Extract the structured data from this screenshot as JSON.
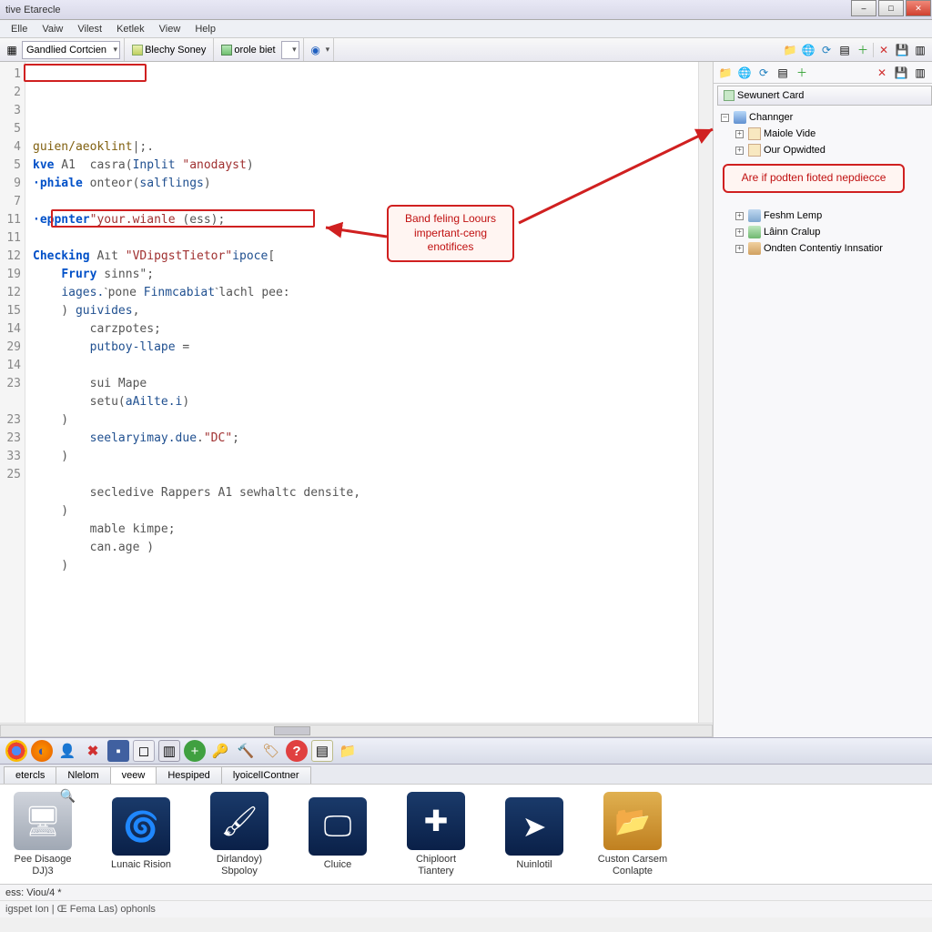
{
  "window": {
    "title": "tive Etarecle"
  },
  "menu": {
    "items": [
      "Elle",
      "Vaiw",
      "Vilest",
      "Ketlek",
      "View",
      "Help"
    ]
  },
  "toolbar": {
    "combo1": "Gandlied Cortcien",
    "btn_blechy": "Blechy Soney",
    "btn_orole": "orole biet"
  },
  "code": {
    "gutter": [
      "1",
      "2",
      "3",
      "5",
      "4",
      "5",
      "9",
      "7",
      "11",
      "11",
      "12",
      "19",
      "12",
      "15",
      "14",
      "29",
      "14",
      "23",
      "",
      "23",
      "23",
      "33",
      "25",
      ""
    ],
    "lines": [
      {
        "segments": [
          {
            "cls": "id",
            "t": "guien/aeoklint"
          },
          {
            "cls": "pl",
            "t": "|;."
          }
        ]
      },
      {
        "segments": [
          {
            "cls": "kw",
            "t": "kve"
          },
          {
            "cls": "pl",
            "t": " A1  casra("
          },
          {
            "cls": "fn",
            "t": "Inplit"
          },
          {
            "cls": "pl",
            "t": " "
          },
          {
            "cls": "str",
            "t": "\"anodayst"
          },
          {
            "cls": "pl",
            "t": ")"
          }
        ]
      },
      {
        "segments": [
          {
            "cls": "kw",
            "t": "·phiale"
          },
          {
            "cls": "pl",
            "t": " onteor("
          },
          {
            "cls": "fn",
            "t": "salflings"
          },
          {
            "cls": "pl",
            "t": ")"
          }
        ]
      },
      {
        "segments": []
      },
      {
        "segments": [
          {
            "cls": "kw",
            "t": "·eppnter"
          },
          {
            "cls": "str",
            "t": "\"your.wianle"
          },
          {
            "cls": "pl",
            "t": " (ess);"
          }
        ]
      },
      {
        "segments": []
      },
      {
        "segments": [
          {
            "cls": "kw",
            "t": "Checking"
          },
          {
            "cls": "pl",
            "t": " Aıt "
          },
          {
            "cls": "str",
            "t": "\"VDipgstTietor\""
          },
          {
            "cls": "fn",
            "t": "ipoce"
          },
          {
            "cls": "pl",
            "t": "["
          }
        ]
      },
      {
        "segments": [
          {
            "cls": "pl",
            "t": "    "
          },
          {
            "cls": "kw",
            "t": "Frury"
          },
          {
            "cls": "pl",
            "t": " sinns\";"
          }
        ]
      },
      {
        "segments": [
          {
            "cls": "pl",
            "t": "    "
          },
          {
            "cls": "fn",
            "t": "iages."
          },
          {
            "cls": "pl",
            "t": "ˋpone "
          },
          {
            "cls": "fn",
            "t": "Finmcabiat"
          },
          {
            "cls": "pl",
            "t": "ˋlachl pee:"
          }
        ]
      },
      {
        "segments": [
          {
            "cls": "pl",
            "t": "    ) "
          },
          {
            "cls": "fn",
            "t": "guivides"
          },
          {
            "cls": "pl",
            "t": ","
          }
        ]
      },
      {
        "segments": [
          {
            "cls": "pl",
            "t": "        carzpotes;"
          }
        ]
      },
      {
        "segments": [
          {
            "cls": "pl",
            "t": "        "
          },
          {
            "cls": "fn",
            "t": "putboy-llape"
          },
          {
            "cls": "pl",
            "t": " ="
          }
        ]
      },
      {
        "segments": []
      },
      {
        "segments": [
          {
            "cls": "pl",
            "t": "        sui Mape"
          }
        ]
      },
      {
        "segments": [
          {
            "cls": "pl",
            "t": "        setu("
          },
          {
            "cls": "fn",
            "t": "aAilte.i"
          },
          {
            "cls": "pl",
            "t": ")"
          }
        ]
      },
      {
        "segments": [
          {
            "cls": "pl",
            "t": "    )"
          }
        ]
      },
      {
        "segments": [
          {
            "cls": "pl",
            "t": "        "
          },
          {
            "cls": "fn",
            "t": "seelaryimay.due"
          },
          {
            "cls": "pl",
            "t": "."
          },
          {
            "cls": "str",
            "t": "\"DC\""
          },
          {
            "cls": "pl",
            "t": ";"
          }
        ]
      },
      {
        "segments": [
          {
            "cls": "pl",
            "t": "    )"
          }
        ]
      },
      {
        "segments": []
      },
      {
        "segments": [
          {
            "cls": "pl",
            "t": "        secledive Rappers A1 sewhaltc densite,"
          }
        ]
      },
      {
        "segments": [
          {
            "cls": "pl",
            "t": "    )"
          }
        ]
      },
      {
        "segments": [
          {
            "cls": "pl",
            "t": "        mable kimpe;"
          }
        ]
      },
      {
        "segments": [
          {
            "cls": "pl",
            "t": "        can.age )"
          }
        ]
      },
      {
        "segments": [
          {
            "cls": "pl",
            "t": "    )"
          }
        ]
      }
    ]
  },
  "sidebar": {
    "tab": "Sewunert Card",
    "root": "Channger",
    "items": [
      "Maiole Vide",
      "Our Opwidted",
      "Feshm Lemp",
      "Lâinn Cralup",
      "Ondten Contentiy Innsatior"
    ],
    "callout": "Are if podten fioted nepdiecce"
  },
  "callouts": {
    "center": "Band feling Loours impertant-ceng enotifices"
  },
  "bottom_tabs": [
    "etercls",
    "Nlelom",
    "veew",
    "Hespiped",
    "lyoicelIContner"
  ],
  "large_icons": [
    {
      "label": "Pee Disaoge DJ)3"
    },
    {
      "label": "Lunaic Rision"
    },
    {
      "label": "Dirlandoy) Sbpoloy"
    },
    {
      "label": "Cluice"
    },
    {
      "label": "Chiploort Tiantery"
    },
    {
      "label": "Nuinlotil"
    },
    {
      "label": "Custon Carsem Conlapte"
    }
  ],
  "status": {
    "line1": "ess: Viou/4 *",
    "line2": "igspet Ion | Œ Fema Las) ophonls"
  }
}
